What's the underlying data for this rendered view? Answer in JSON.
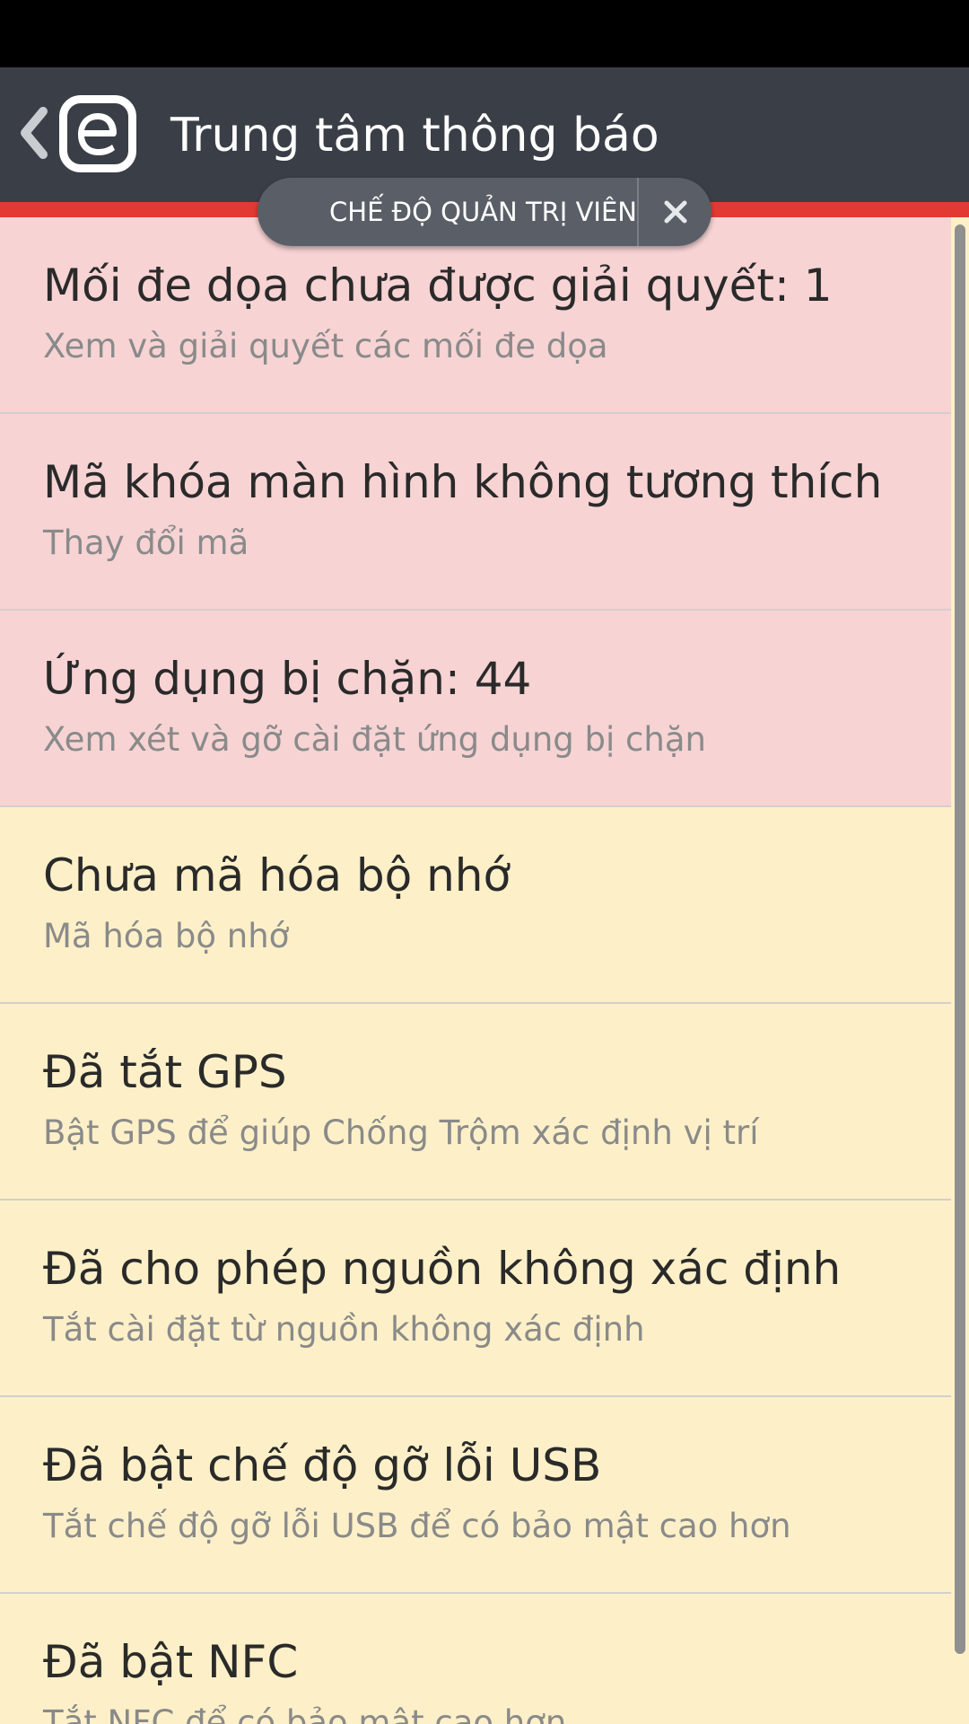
{
  "header": {
    "title": "Trung tâm thông báo",
    "logo_letter": "e",
    "icons": {
      "back": "chevron-left-icon",
      "logo": "eset-logo-icon"
    }
  },
  "admin_mode": {
    "label": "CHẾ ĐỘ QUẢN TRỊ VIÊN",
    "close_icon": "close-icon"
  },
  "colors": {
    "status_bar": "#000000",
    "app_bar": "#3a3e46",
    "accent_red": "#e23a33",
    "item_red_bg": "#f7d3d4",
    "item_yellow_bg": "#fdf0c8",
    "pill_bg": "#5a5f67"
  },
  "notifications": [
    {
      "title": "Mối đe dọa chưa được giải quyết: 1",
      "subtitle": "Xem và giải quyết các mối đe dọa",
      "severity": "red"
    },
    {
      "title": "Mã khóa màn hình không tương thích",
      "subtitle": "Thay đổi mã",
      "severity": "red"
    },
    {
      "title": "Ứng dụng bị chặn: 44",
      "subtitle": "Xem xét và gỡ cài đặt ứng dụng bị chặn",
      "severity": "red"
    },
    {
      "title": "Chưa mã hóa bộ nhớ",
      "subtitle": "Mã hóa bộ nhớ",
      "severity": "yellow"
    },
    {
      "title": "Đã tắt GPS",
      "subtitle": "Bật GPS để giúp Chống Trộm xác định vị trí",
      "severity": "yellow"
    },
    {
      "title": "Đã cho phép nguồn không xác định",
      "subtitle": "Tắt cài đặt từ nguồn không xác định",
      "severity": "yellow"
    },
    {
      "title": "Đã bật chế độ gỡ lỗi USB",
      "subtitle": "Tắt chế độ gỡ lỗi USB để có bảo mật cao hơn",
      "severity": "yellow"
    },
    {
      "title": "Đã bật NFC",
      "subtitle": "Tắt NFC để có bảo mật cao hơn",
      "severity": "yellow"
    }
  ]
}
